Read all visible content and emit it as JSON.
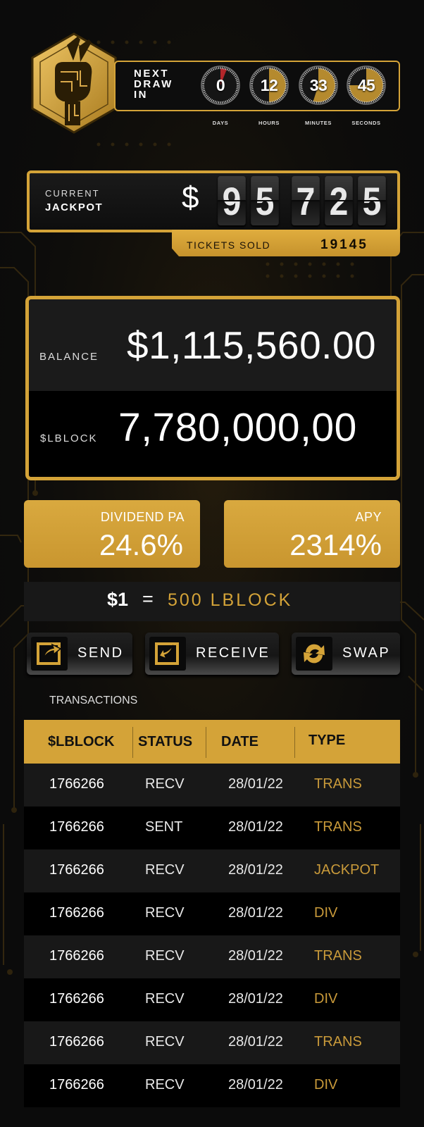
{
  "countdown": {
    "title": "NEXT\nDRAW\nIN",
    "units": [
      {
        "value": "0",
        "label": "DAYS"
      },
      {
        "value": "12",
        "label": "HOURS"
      },
      {
        "value": "33",
        "label": "MINUTES"
      },
      {
        "value": "45",
        "label": "SECONDS"
      }
    ],
    "progress": [
      0.06,
      0.5,
      0.55,
      0.75
    ]
  },
  "jackpot": {
    "label_top": "CURRENT",
    "label_bottom": "JACKPOT",
    "currency": "$",
    "digits": [
      "9",
      "5",
      "7",
      "2",
      "5"
    ],
    "tickets_label": "TICKETS SOLD",
    "tickets_value": "19145"
  },
  "balance": {
    "balance_label": "BALANCE",
    "balance_value": "$1,115,560.00",
    "token_label": "$LBLOCK",
    "token_value": "7,780,000,00"
  },
  "stats": {
    "dividend_label": "DIVIDEND PA",
    "dividend_value": "24.6%",
    "apy_label": "APY",
    "apy_value": "2314%"
  },
  "rate": {
    "left": "$1",
    "equals": "=",
    "right": "500 LBLOCK"
  },
  "actions": {
    "send": "SEND",
    "receive": "RECEIVE",
    "swap": "SWAP"
  },
  "transactions": {
    "heading": "TRANSACTIONS",
    "columns": [
      "$LBLOCK",
      "STATUS",
      "DATE",
      "TYPE"
    ],
    "rows": [
      {
        "amount": "1766266",
        "status": "RECV",
        "date": "28/01/22",
        "type": "TRANS"
      },
      {
        "amount": "1766266",
        "status": "SENT",
        "date": "28/01/22",
        "type": "TRANS"
      },
      {
        "amount": "1766266",
        "status": "RECV",
        "date": "28/01/22",
        "type": "JACKPOT"
      },
      {
        "amount": "1766266",
        "status": "RECV",
        "date": "28/01/22",
        "type": "DIV"
      },
      {
        "amount": "1766266",
        "status": "RECV",
        "date": "28/01/22",
        "type": "TRANS"
      },
      {
        "amount": "1766266",
        "status": "RECV",
        "date": "28/01/22",
        "type": "DIV"
      },
      {
        "amount": "1766266",
        "status": "RECV",
        "date": "28/01/22",
        "type": "TRANS"
      },
      {
        "amount": "1766266",
        "status": "RECV",
        "date": "28/01/22",
        "type": "DIV"
      }
    ]
  },
  "colors": {
    "accent": "#d4a338",
    "background": "#0b0b0b",
    "type_text": "#c99a3a"
  },
  "icons": [
    "crossed-fingers-logo-icon",
    "send-icon",
    "receive-icon",
    "swap-icon"
  ]
}
